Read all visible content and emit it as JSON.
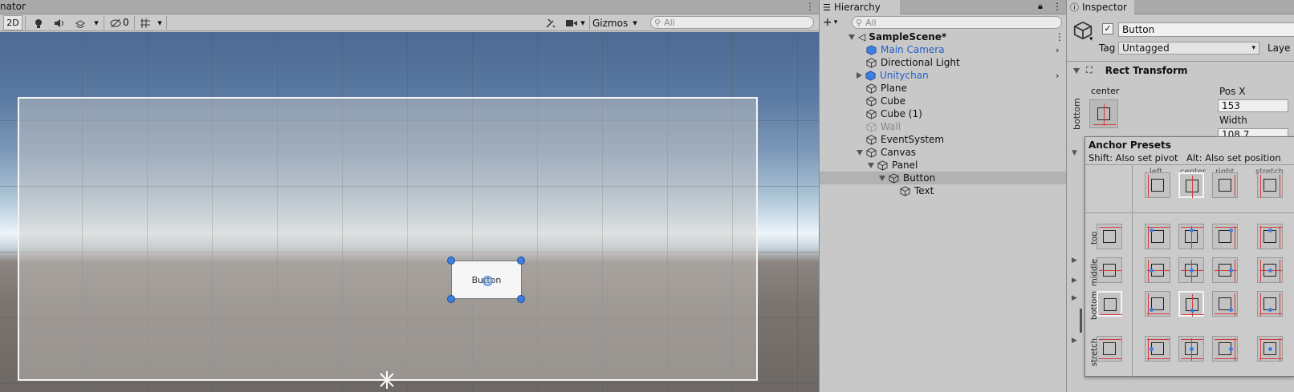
{
  "scene": {
    "tab_label": "nator",
    "toolbar": {
      "btn_2d": "2D",
      "hidden_count": "0",
      "gizmos_label": "Gizmos",
      "search_placeholder": "All"
    },
    "button_widget_text": "Button"
  },
  "hierarchy": {
    "tab_label": "Hierarchy",
    "search_placeholder": "All",
    "scene_name": "SampleScene*",
    "items": [
      {
        "label": "Main Camera",
        "color": "#1f5fc7"
      },
      {
        "label": "Directional Light",
        "color": "#111111"
      },
      {
        "label": "Unitychan",
        "color": "#1f5fc7"
      },
      {
        "label": "Plane",
        "color": "#111111"
      },
      {
        "label": "Cube",
        "color": "#111111"
      },
      {
        "label": "Cube (1)",
        "color": "#111111"
      },
      {
        "label": "Wall",
        "color": "#8a8a8a"
      },
      {
        "label": "EventSystem",
        "color": "#111111"
      },
      {
        "label": "Canvas",
        "color": "#111111"
      },
      {
        "label": "Panel",
        "color": "#111111"
      },
      {
        "label": "Button",
        "color": "#111111"
      },
      {
        "label": "Text",
        "color": "#111111"
      }
    ]
  },
  "inspector": {
    "tab_label": "Inspector",
    "object_name": "Button",
    "tag_label": "Tag",
    "tag_value": "Untagged",
    "layer_label": "Laye",
    "component_title": "Rect Transform",
    "anchor_h_label": "center",
    "anchor_v_label": "bottom",
    "pos_x_label": "Pos X",
    "pos_x_value": "153",
    "width_label": "Width",
    "width_value": "108.7",
    "presets": {
      "title": "Anchor Presets",
      "shift_hint": "Shift: Also set pivot",
      "alt_hint": "Alt: Also set position",
      "columns": [
        "left",
        "center",
        "right",
        "stretch"
      ],
      "rows": [
        "top",
        "middle",
        "bottom",
        "stretch"
      ]
    }
  }
}
